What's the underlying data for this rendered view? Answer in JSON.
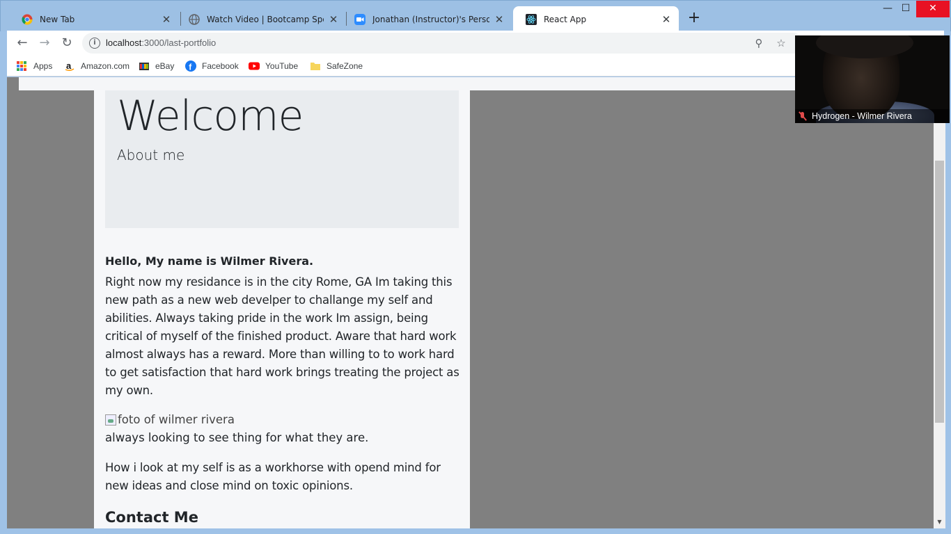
{
  "browser": {
    "tabs": [
      {
        "title": "New Tab",
        "icon": "chrome-icon",
        "active": false
      },
      {
        "title": "Watch Video | Bootcamp Spot",
        "icon": "globe-icon",
        "active": false
      },
      {
        "title": "Jonathan (Instructor)'s Personal M",
        "icon": "zoom-icon",
        "active": false
      },
      {
        "title": "React App",
        "icon": "react-icon",
        "active": true
      }
    ],
    "tab_close_glyph": "✕",
    "new_tab_glyph": "+",
    "window_controls": {
      "minimize": "—",
      "maximize": "☐",
      "close": "✕"
    },
    "address": {
      "host": "localhost",
      "path": ":3000/last-portfolio"
    },
    "bookmarks": [
      {
        "label": "Apps",
        "icon": "apps-grid-icon"
      },
      {
        "label": "Amazon.com",
        "icon": "amazon-icon"
      },
      {
        "label": "eBay",
        "icon": "ebay-icon"
      },
      {
        "label": "Facebook",
        "icon": "facebook-icon"
      },
      {
        "label": "YouTube",
        "icon": "youtube-icon"
      },
      {
        "label": "SafeZone",
        "icon": "folder-icon"
      }
    ]
  },
  "page": {
    "jumbotron": {
      "title": "Welcome",
      "subtitle": "About me"
    },
    "greeting": "Hello, My name is Wilmer Rivera.",
    "bio": "Right now my residance is in the city Rome, GA Im taking this new path as a new web develper to challange my self and abilities. Always taking pride in the work Im assign, being critical of myself of the finished product. Aware that hard work almost always has a reward. More than willing to to work hard to get satisfaction that hard work brings treating the project as my own.",
    "image_alt": "foto of wilmer rivera",
    "tagline": "always looking to see thing for what they are.",
    "workhorse": "How i look at my self is as a workhorse with opend mind for new ideas and close mind on toxic opinions.",
    "contact_heading": "Contact Me"
  },
  "video_overlay": {
    "participant_name": "Hydrogen - Wilmer Rivera",
    "muted": true
  },
  "colors": {
    "page_background": "#808080",
    "card_background": "#f6f7f9",
    "jumbotron_background": "#e9ecef",
    "close_button_red": "#e81123"
  }
}
